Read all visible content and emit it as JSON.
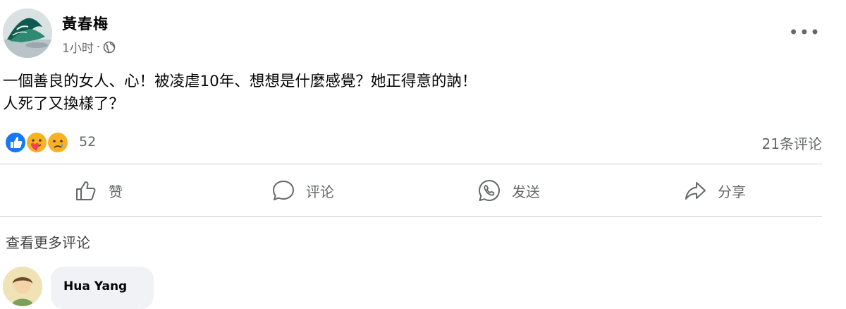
{
  "post": {
    "author": "黃春梅",
    "time": "1小时",
    "meta_sep": "·",
    "privacy_icon": "globe-icon",
    "more_label": "•••",
    "text": "一個善良的女人、心！被凌虐10年、想想是什麼感覺？她正得意的訥！\n人死了又換樣了？"
  },
  "reactions": {
    "icons": [
      "like-icon",
      "care-icon",
      "sad-icon"
    ],
    "count": "52",
    "comments_count": "21条评论"
  },
  "actions": [
    {
      "icon": "thumbs-up-icon",
      "label": "赞"
    },
    {
      "icon": "comment-icon",
      "label": "评论"
    },
    {
      "icon": "whatsapp-icon",
      "label": "发送"
    },
    {
      "icon": "share-icon",
      "label": "分享"
    }
  ],
  "comments": {
    "more_label": "查看更多评论",
    "items": [
      {
        "author": "Hua Yang"
      }
    ]
  },
  "colors": {
    "secondary_text": "#65676b",
    "divider": "#ced0d4",
    "like_blue": "#1877f2",
    "bubble_bg": "#f0f2f5"
  }
}
